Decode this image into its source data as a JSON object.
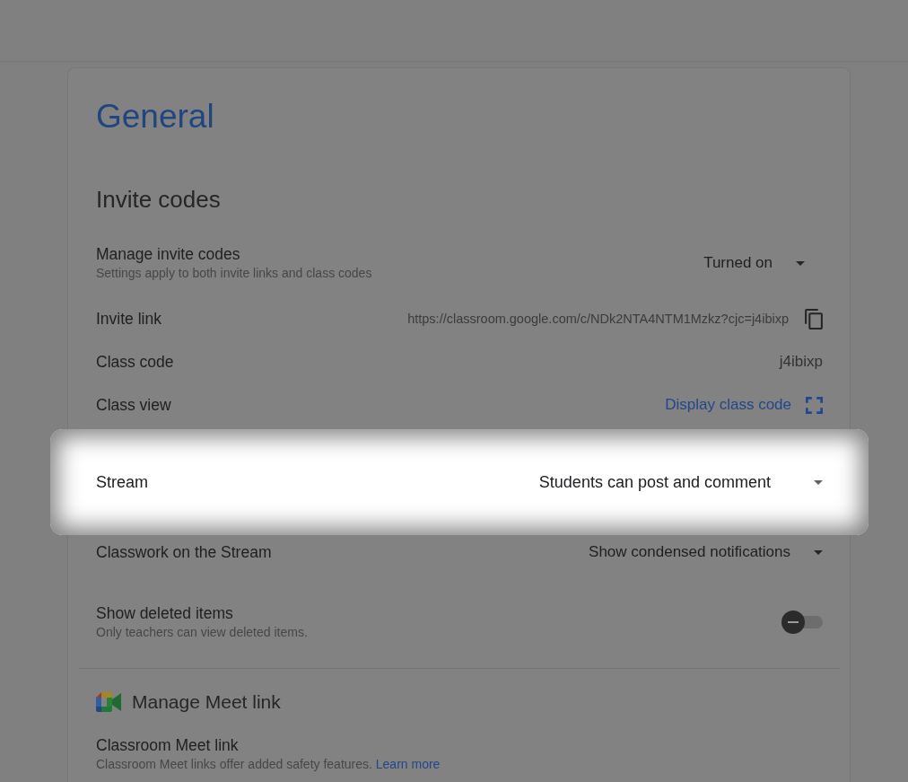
{
  "title": "General",
  "invite_codes": {
    "heading": "Invite codes",
    "rows": [
      {
        "kind": "dropdown",
        "label": "Manage invite codes",
        "description": "Settings apply to both invite links and class codes",
        "value": "Turned on",
        "highlighted": false
      },
      {
        "kind": "copy_link",
        "label": "Invite link",
        "value": "https://classroom.google.com/c/NDk2NTA4NTM1Mzkz?cjc=j4ibixp",
        "highlighted": false
      },
      {
        "kind": "text",
        "label": "Class code",
        "value": "j4ibixp",
        "highlighted": false
      },
      {
        "kind": "action_link",
        "label": "Class view",
        "value": "Display class code",
        "highlighted": false
      }
    ]
  },
  "settings": [
    {
      "kind": "dropdown",
      "label": "Stream",
      "value": "Students can post and comment",
      "highlighted": true
    },
    {
      "kind": "dropdown",
      "label": "Classwork on the Stream",
      "value": "Show condensed notifications",
      "highlighted": false
    },
    {
      "kind": "toggle",
      "label": "Show deleted items",
      "description": "Only teachers can view deleted items.",
      "on": false,
      "highlighted": false
    }
  ],
  "meet": {
    "heading": "Manage Meet link",
    "rows": [
      {
        "label": "Classroom Meet link",
        "description": "Classroom Meet links offer added safety features.",
        "link": "Learn more"
      }
    ]
  }
}
